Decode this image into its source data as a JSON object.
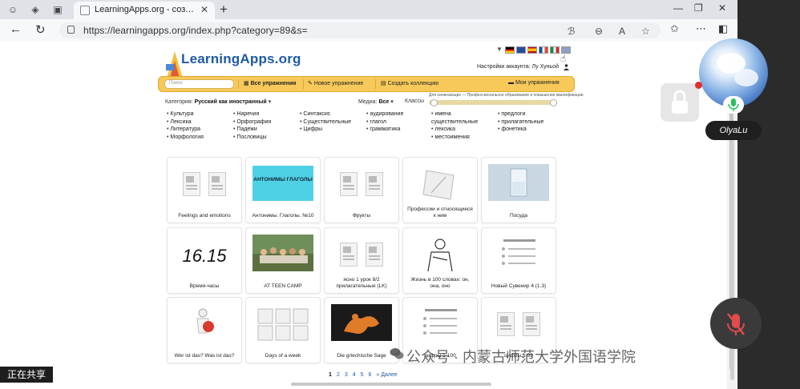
{
  "browser": {
    "tab_title": "LearningApps.org - создание мул",
    "url": "https://learningapps.org/index.php?category=89&s=",
    "new_tab_label": "+",
    "tab_close_label": "✕"
  },
  "site": {
    "logo_text": "LearningApps.org",
    "account_label": "Настройки аккаунта: Лу Хуньой",
    "nav": {
      "search_placeholder": "Поиск",
      "all_exercises": "Все упражнения",
      "new_exercise": "Новое упражнение",
      "create_collection": "Создать коллекцию",
      "my_exercises": "Мои упражнения"
    },
    "filters": {
      "category_label": "Категория:",
      "category_value": "Русский как иностранный",
      "media_label": "Медиа:",
      "media_value": "Все",
      "classes_label": "Классы",
      "range_text": "Для начинающих — Профессиональное образование и повышение квалификации"
    },
    "categories": [
      [
        "Культура",
        "Лексика",
        "Литература",
        "Морфология"
      ],
      [
        "Наречия",
        "Орфография",
        "Падежи",
        "Пословицы"
      ],
      [
        "Синтаксис",
        "Существительные",
        "Цифры"
      ],
      [
        "аудирование",
        "глагол",
        "грамматика"
      ],
      [
        "имена существительные",
        "лексика",
        "местоимения"
      ],
      [
        "предлоги",
        "прилагательные",
        "фонетика"
      ]
    ],
    "cards": [
      {
        "title": "Feelings and emotions",
        "thumb": "docs"
      },
      {
        "title": "Антонимы. Глаголы. №10",
        "thumb": "cyan-label",
        "thumb_text": "АНТОНИМЫ ГЛАГОЛЫ"
      },
      {
        "title": "Фрукты",
        "thumb": "docs"
      },
      {
        "title": "Профессии и относящиеся к ним",
        "thumb": "sketch"
      },
      {
        "title": "Посуда",
        "thumb": "glass"
      },
      {
        "title": "Время-часы",
        "thumb": "clock-text",
        "thumb_text": "16.15"
      },
      {
        "title": "AT TEEN CAMP",
        "thumb": "photo"
      },
      {
        "title": "ясно 1 урок 8/2 прилагательные (LK)",
        "thumb": "docs"
      },
      {
        "title": "Жизнь в 100 словах: он, она, оно",
        "thumb": "person"
      },
      {
        "title": "Новый Сувенир 4 (1.3)",
        "thumb": "list"
      },
      {
        "title": "Wer ist das? Was ist das?",
        "thumb": "red-figure"
      },
      {
        "title": "Days of a week",
        "thumb": "grid"
      },
      {
        "title": "Die griechische Sage",
        "thumb": "vase"
      },
      {
        "title": "цифры 1-100",
        "thumb": "list"
      },
      {
        "title": "цифры 1-99",
        "thumb": "docs"
      }
    ],
    "pagination": {
      "pages": [
        "1",
        "2",
        "3",
        "4",
        "5",
        "6"
      ],
      "current": "1",
      "next_label": "» Далее"
    }
  },
  "meeting": {
    "participant_name": "OlyaLu",
    "sharing_label": "正在共享",
    "watermark_text": "公众号 · 内蒙古师范大学外国语学院"
  },
  "colors": {
    "nav_yellow": "#f6c95a",
    "logo_blue": "#1d5aa6",
    "record_red": "#e03030"
  }
}
